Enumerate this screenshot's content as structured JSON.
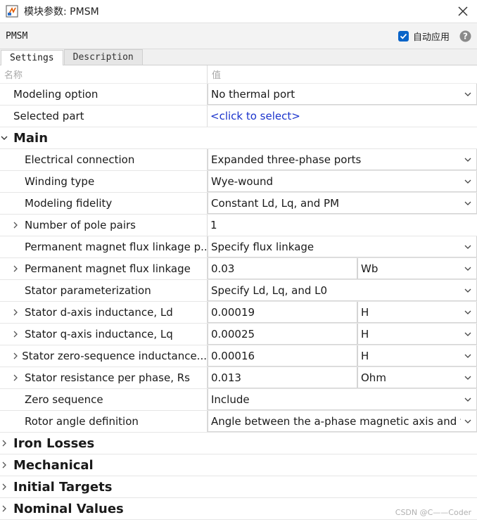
{
  "window": {
    "title": "模块参数: PMSM"
  },
  "block": {
    "name": "PMSM",
    "auto_apply_label": "自动应用",
    "auto_apply_checked": true
  },
  "tabs": [
    {
      "label": "Settings",
      "active": true
    },
    {
      "label": "Description",
      "active": false
    }
  ],
  "columns": {
    "name": "名称",
    "value": "值"
  },
  "top_rows": {
    "modeling_option": {
      "label": "Modeling option",
      "value": "No thermal port"
    },
    "selected_part": {
      "label": "Selected part",
      "value": "<click to select>"
    }
  },
  "main": {
    "label": "Main",
    "rows": {
      "electrical_connection": {
        "label": "Electrical connection",
        "value": "Expanded three-phase ports"
      },
      "winding_type": {
        "label": "Winding type",
        "value": "Wye-wound"
      },
      "modeling_fidelity": {
        "label": "Modeling fidelity",
        "value": "Constant Ld, Lq, and PM"
      },
      "pole_pairs": {
        "label": "Number of pole pairs",
        "value": "1"
      },
      "pm_param": {
        "label": "Permanent magnet flux linkage p...",
        "value": "Specify flux linkage"
      },
      "pm_flux": {
        "label": "Permanent magnet flux linkage",
        "value": "0.03",
        "unit": "Wb"
      },
      "stator_param": {
        "label": "Stator parameterization",
        "value": "Specify Ld, Lq, and L0"
      },
      "ld": {
        "label": "Stator d-axis inductance, Ld",
        "value": "0.00019",
        "unit": "H"
      },
      "lq": {
        "label": "Stator q-axis inductance, Lq",
        "value": "0.00025",
        "unit": "H"
      },
      "l0": {
        "label": "Stator zero-sequence inductance...",
        "value": "0.00016",
        "unit": "H"
      },
      "rs": {
        "label": "Stator resistance per phase, Rs",
        "value": "0.013",
        "unit": "Ohm"
      },
      "zero_seq": {
        "label": "Zero sequence",
        "value": "Include"
      },
      "rotor_angle": {
        "label": "Rotor angle definition",
        "value": "Angle between the a-phase magnetic axis and the"
      }
    }
  },
  "sections": {
    "iron_losses": "Iron Losses",
    "mechanical": "Mechanical",
    "initial_targets": "Initial Targets",
    "nominal_values": "Nominal Values"
  },
  "watermark": "CSDN @C——Coder",
  "colors": {
    "accent": "#0a64c8",
    "link": "#1a33cc"
  }
}
